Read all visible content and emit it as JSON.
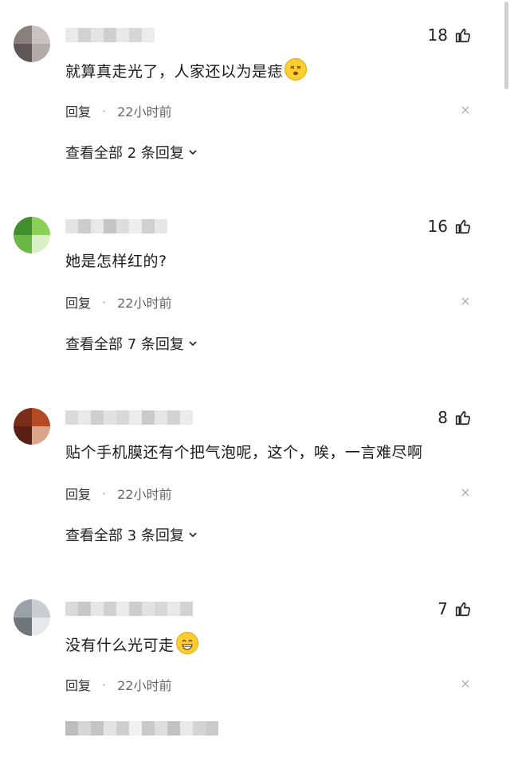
{
  "comments": [
    {
      "likes": "18",
      "text": "就算真走光了，人家还以为是痣",
      "emoji": "dizzy-face-emoji",
      "reply_label": "回复",
      "time": "22小时前",
      "view_replies": "查看全部 2 条回复",
      "avatar_colors": [
        "#8a7f7a",
        "#c9c2bf",
        "#5e5755",
        "#b3aba8"
      ]
    },
    {
      "likes": "16",
      "text": "她是怎样红的?",
      "reply_label": "回复",
      "time": "22小时前",
      "view_replies": "查看全部 7 条回复",
      "avatar_colors": [
        "#3f8f2e",
        "#8bcf5a",
        "#6bb844",
        "#d9efc4"
      ]
    },
    {
      "likes": "8",
      "text": "贴个手机膜还有个把气泡呢，这个，唉，一言难尽啊",
      "reply_label": "回复",
      "time": "22小时前",
      "view_replies": "查看全部 3 条回复",
      "avatar_colors": [
        "#7a2e1a",
        "#b24a26",
        "#5a2013",
        "#d9a58c"
      ]
    },
    {
      "likes": "7",
      "text": "没有什么光可走",
      "emoji": "grinning-face-emoji",
      "reply_label": "回复",
      "time": "22小时前",
      "avatar_colors": [
        "#9aa1a8",
        "#c9ced3",
        "#6f767c",
        "#e6e8ea"
      ]
    }
  ],
  "colors": {
    "text": "#1a1a1a",
    "meta": "#666666",
    "emoji_yellow": "#ffcc33",
    "blur_light": "#e8e8e8",
    "blur_dark": "#bdbdbd"
  }
}
